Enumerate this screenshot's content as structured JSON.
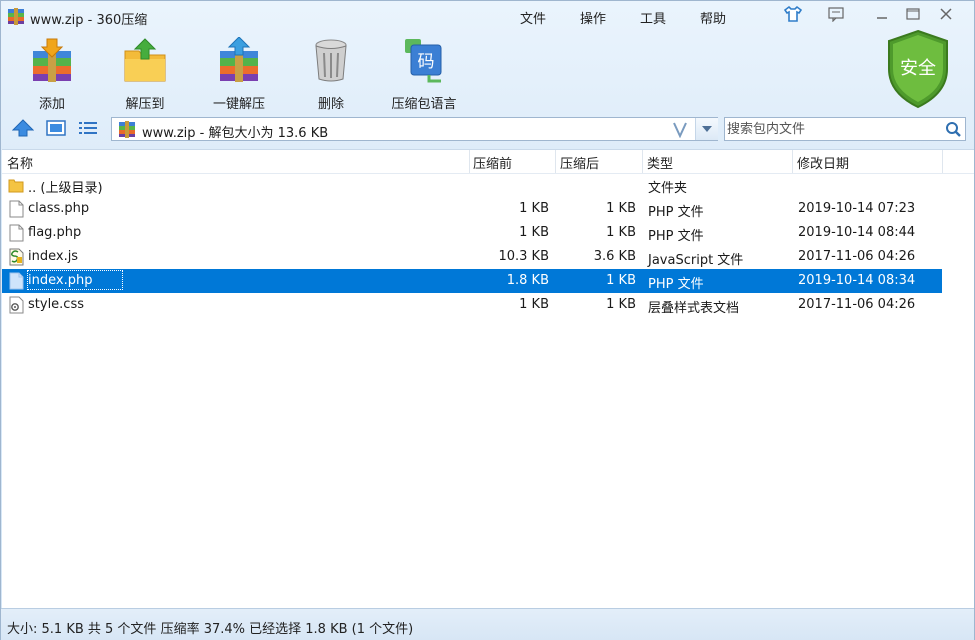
{
  "window": {
    "title": "www.zip - 360压缩",
    "menu": [
      "文件",
      "操作",
      "工具",
      "帮助"
    ]
  },
  "toolbar": {
    "add": "添加",
    "extract_to": "解压到",
    "one_click_extract": "一键解压",
    "delete": "删除",
    "archive_language": "压缩包语言",
    "security_badge": "安全",
    "code_badge": "码"
  },
  "address": {
    "path": "www.zip - 解包大小为 13.6 KB",
    "search_placeholder": "搜索包内文件"
  },
  "columns": [
    "名称",
    "压缩前",
    "压缩后",
    "类型",
    "修改日期"
  ],
  "files": [
    {
      "name": ".. (上级目录)",
      "size": "",
      "packed": "",
      "type": "文件夹",
      "date": "",
      "icon": "folder-icon"
    },
    {
      "name": "class.php",
      "size": "1 KB",
      "packed": "1 KB",
      "type": "PHP 文件",
      "date": "2019-10-14 07:23",
      "icon": "file-icon"
    },
    {
      "name": "flag.php",
      "size": "1 KB",
      "packed": "1 KB",
      "type": "PHP 文件",
      "date": "2019-10-14 08:44",
      "icon": "file-icon"
    },
    {
      "name": "index.js",
      "size": "10.3 KB",
      "packed": "3.6 KB",
      "type": "JavaScript 文件",
      "date": "2017-11-06 04:26",
      "icon": "script-file-icon"
    },
    {
      "name": "index.php",
      "size": "1.8 KB",
      "packed": "1 KB",
      "type": "PHP 文件",
      "date": "2019-10-14 08:34",
      "icon": "file-icon",
      "selected": true
    },
    {
      "name": "style.css",
      "size": "1 KB",
      "packed": "1 KB",
      "type": "层叠样式表文档",
      "date": "2017-11-06 04:26",
      "icon": "css-file-icon"
    }
  ],
  "status": {
    "text": "大小: 5.1 KB 共 5 个文件 压缩率 37.4% 已经选择 1.8 KB (1 个文件)"
  },
  "colors": {
    "selection": "#0078d7",
    "window_bg": "#dbeaf8",
    "shield_green": "#5aa332"
  }
}
